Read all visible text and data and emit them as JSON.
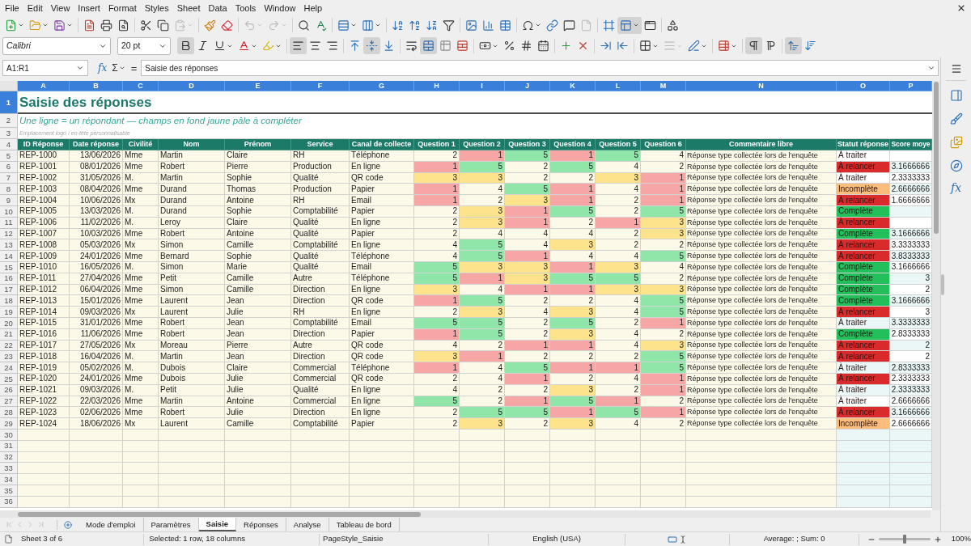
{
  "menu_bar": {
    "items": [
      "File",
      "Edit",
      "View",
      "Insert",
      "Format",
      "Styles",
      "Sheet",
      "Data",
      "Tools",
      "Window",
      "Help"
    ]
  },
  "standard_toolbar": {
    "paste_disabled": true,
    "undo_disabled": true,
    "redo_disabled": true,
    "headers_footers_disabled": true,
    "freeze_pressed": true
  },
  "formatting_toolbar": {
    "font_name": "Calibri",
    "font_size": "20 pt",
    "bold": true,
    "italic": false,
    "underline": false,
    "align_left": true,
    "align_center": false,
    "align_right": false,
    "align_top": false,
    "align_middle": true,
    "align_bottom": false,
    "wrap_text": false,
    "merge_center": true,
    "border_style_disabled": true,
    "left_to_right": true,
    "right_to_left": false,
    "text_up": true,
    "text_down": false
  },
  "formula_bar": {
    "name_box": "A1:R1",
    "function_wizard": "fx",
    "sum": "Σ",
    "equals": "=",
    "content": "Saisie des réponses"
  },
  "sidebar": {
    "functions": "fx"
  },
  "sheet": {
    "columns": [
      {
        "letter": "A",
        "header": "ID Réponse",
        "selected": true
      },
      {
        "letter": "B",
        "header": "Date réponse",
        "selected": true
      },
      {
        "letter": "C",
        "header": "Civilité",
        "selected": true
      },
      {
        "letter": "D",
        "header": "Nom",
        "selected": true
      },
      {
        "letter": "E",
        "header": "Prénom",
        "selected": true
      },
      {
        "letter": "F",
        "header": "Service",
        "selected": true
      },
      {
        "letter": "G",
        "header": "Canal de collecte",
        "selected": true
      },
      {
        "letter": "H",
        "header": "Question 1",
        "selected": true
      },
      {
        "letter": "I",
        "header": "Question 2",
        "selected": true
      },
      {
        "letter": "J",
        "header": "Question 3",
        "selected": true
      },
      {
        "letter": "K",
        "header": "Question 4",
        "selected": true
      },
      {
        "letter": "L",
        "header": "Question 5",
        "selected": true
      },
      {
        "letter": "M",
        "header": "Question 6",
        "selected": true
      },
      {
        "letter": "N",
        "header": "Commentaire libre",
        "selected": true
      },
      {
        "letter": "O",
        "header": "Statut réponse",
        "selected": true
      },
      {
        "letter": "P",
        "header": "Score moye",
        "selected": true
      }
    ],
    "header_rows": [
      {
        "number": "1",
        "selected": true
      },
      {
        "number": "2",
        "selected": false
      },
      {
        "number": "3",
        "selected": false
      },
      {
        "number": "4",
        "selected": false
      }
    ],
    "title": "Saisie des réponses",
    "subtitle": "Une ligne = un répondant — champs en fond jaune pâle à compléter",
    "note": "Emplacement logo / en-tête personnalisable",
    "rows": [
      {
        "number": "5",
        "selected": false,
        "id": "REP-1000",
        "date": "13/06/2026",
        "civility": "Mme",
        "last_name": "Martin",
        "first_name": "Claire",
        "service": "RH",
        "channel": "Téléphone",
        "answers": [
          {
            "value": "2",
            "color": "#fdf9e9"
          },
          {
            "value": "1",
            "color": "#f7a6a6"
          },
          {
            "value": "5",
            "color": "#8fe6a8"
          },
          {
            "value": "1",
            "color": "#f7a6a6"
          },
          {
            "value": "5",
            "color": "#8fe6a8"
          },
          {
            "value": "4",
            "color": "#fdf9e9"
          }
        ],
        "comment": "Réponse type collectée lors de l'enquête",
        "status": {
          "label": "À traiter",
          "color": "#ffffff"
        }
      },
      {
        "number": "6",
        "selected": false,
        "id": "REP-1001",
        "date": "08/01/2026",
        "civility": "Mme",
        "last_name": "Robert",
        "first_name": "Pierre",
        "service": "Production",
        "channel": "En ligne",
        "answers": [
          {
            "value": "1",
            "color": "#f7a6a6"
          },
          {
            "value": "5",
            "color": "#8fe6a8"
          },
          {
            "value": "2",
            "color": "#fdf9e9"
          },
          {
            "value": "5",
            "color": "#8fe6a8"
          },
          {
            "value": "4",
            "color": "#fdf9e9"
          },
          {
            "value": "2",
            "color": "#fdf9e9"
          }
        ],
        "comment": "Réponse type collectée lors de l'enquête",
        "status": {
          "label": "À relancer",
          "color": "#d92b2b"
        },
        "score": "3.1666666"
      },
      {
        "number": "7",
        "selected": false,
        "id": "REP-1002",
        "date": "31/05/2026",
        "civility": "M.",
        "last_name": "Martin",
        "first_name": "Sophie",
        "service": "Qualité",
        "channel": "QR code",
        "answers": [
          {
            "value": "3",
            "color": "#fde38c"
          },
          {
            "value": "3",
            "color": "#fde38c"
          },
          {
            "value": "2",
            "color": "#fdf9e9"
          },
          {
            "value": "2",
            "color": "#fdf9e9"
          },
          {
            "value": "3",
            "color": "#fde38c"
          },
          {
            "value": "1",
            "color": "#f7a6a6"
          }
        ],
        "comment": "Réponse type collectée lors de l'enquête",
        "status": {
          "label": "À traiter",
          "color": "#ffffff"
        },
        "score": "2.3333333"
      },
      {
        "number": "8",
        "selected": false,
        "id": "REP-1003",
        "date": "08/04/2026",
        "civility": "Mme",
        "last_name": "Durand",
        "first_name": "Thomas",
        "service": "Production",
        "channel": "Papier",
        "answers": [
          {
            "value": "1",
            "color": "#f7a6a6"
          },
          {
            "value": "4",
            "color": "#fdf9e9"
          },
          {
            "value": "5",
            "color": "#8fe6a8"
          },
          {
            "value": "1",
            "color": "#f7a6a6"
          },
          {
            "value": "4",
            "color": "#fdf9e9"
          },
          {
            "value": "1",
            "color": "#f7a6a6"
          }
        ],
        "comment": "Réponse type collectée lors de l'enquête",
        "status": {
          "label": "Incomplète",
          "color": "#fbbd7c"
        },
        "score": "2.6666666"
      },
      {
        "number": "9",
        "selected": false,
        "id": "REP-1004",
        "date": "10/06/2026",
        "civility": "Mx",
        "last_name": "Durand",
        "first_name": "Antoine",
        "service": "RH",
        "channel": "Email",
        "answers": [
          {
            "value": "1",
            "color": "#f7a6a6"
          },
          {
            "value": "2",
            "color": "#fdf9e9"
          },
          {
            "value": "3",
            "color": "#fde38c"
          },
          {
            "value": "1",
            "color": "#f7a6a6"
          },
          {
            "value": "2",
            "color": "#fdf9e9"
          },
          {
            "value": "1",
            "color": "#f7a6a6"
          }
        ],
        "comment": "Réponse type collectée lors de l'enquête",
        "status": {
          "label": "À relancer",
          "color": "#d92b2b"
        },
        "score": "1.6666666"
      },
      {
        "number": "10",
        "selected": false,
        "id": "REP-1005",
        "date": "13/03/2026",
        "civility": "M.",
        "last_name": "Durand",
        "first_name": "Sophie",
        "service": "Comptabilité",
        "channel": "Papier",
        "answers": [
          {
            "value": "2",
            "color": "#fdf9e9"
          },
          {
            "value": "3",
            "color": "#fde38c"
          },
          {
            "value": "1",
            "color": "#f7a6a6"
          },
          {
            "value": "5",
            "color": "#8fe6a8"
          },
          {
            "value": "2",
            "color": "#fdf9e9"
          },
          {
            "value": "5",
            "color": "#8fe6a8"
          }
        ],
        "comment": "Réponse type collectée lors de l'enquête",
        "status": {
          "label": "Complète",
          "color": "#22bf5a"
        }
      },
      {
        "number": "11",
        "selected": false,
        "id": "REP-1006",
        "date": "11/02/2026",
        "civility": "M.",
        "last_name": "Leroy",
        "first_name": "Claire",
        "service": "Qualité",
        "channel": "En ligne",
        "answers": [
          {
            "value": "2",
            "color": "#fdf9e9"
          },
          {
            "value": "3",
            "color": "#fde38c"
          },
          {
            "value": "1",
            "color": "#f7a6a6"
          },
          {
            "value": "2",
            "color": "#fdf9e9"
          },
          {
            "value": "1",
            "color": "#f7a6a6"
          },
          {
            "value": "3",
            "color": "#fde38c"
          }
        ],
        "comment": "Réponse type collectée lors de l'enquête",
        "status": {
          "label": "À relancer",
          "color": "#d92b2b"
        }
      },
      {
        "number": "12",
        "selected": false,
        "id": "REP-1007",
        "date": "10/03/2026",
        "civility": "Mme",
        "last_name": "Robert",
        "first_name": "Antoine",
        "service": "Qualité",
        "channel": "Papier",
        "answers": [
          {
            "value": "2",
            "color": "#fdf9e9"
          },
          {
            "value": "4",
            "color": "#fdf9e9"
          },
          {
            "value": "4",
            "color": "#fdf9e9"
          },
          {
            "value": "4",
            "color": "#fdf9e9"
          },
          {
            "value": "2",
            "color": "#fdf9e9"
          },
          {
            "value": "3",
            "color": "#fde38c"
          }
        ],
        "comment": "Réponse type collectée lors de l'enquête",
        "status": {
          "label": "Complète",
          "color": "#22bf5a"
        },
        "score": "3.1666666"
      },
      {
        "number": "13",
        "selected": false,
        "id": "REP-1008",
        "date": "05/03/2026",
        "civility": "Mx",
        "last_name": "Simon",
        "first_name": "Camille",
        "service": "Comptabilité",
        "channel": "En ligne",
        "answers": [
          {
            "value": "4",
            "color": "#fdf9e9"
          },
          {
            "value": "5",
            "color": "#8fe6a8"
          },
          {
            "value": "4",
            "color": "#fdf9e9"
          },
          {
            "value": "3",
            "color": "#fde38c"
          },
          {
            "value": "2",
            "color": "#fdf9e9"
          },
          {
            "value": "2",
            "color": "#fdf9e9"
          }
        ],
        "comment": "Réponse type collectée lors de l'enquête",
        "status": {
          "label": "À relancer",
          "color": "#d92b2b"
        },
        "score": "3.3333333"
      },
      {
        "number": "14",
        "selected": false,
        "id": "REP-1009",
        "date": "24/01/2026",
        "civility": "Mme",
        "last_name": "Bernard",
        "first_name": "Sophie",
        "service": "Qualité",
        "channel": "Téléphone",
        "answers": [
          {
            "value": "4",
            "color": "#fdf9e9"
          },
          {
            "value": "5",
            "color": "#8fe6a8"
          },
          {
            "value": "1",
            "color": "#f7a6a6"
          },
          {
            "value": "4",
            "color": "#fdf9e9"
          },
          {
            "value": "4",
            "color": "#fdf9e9"
          },
          {
            "value": "5",
            "color": "#8fe6a8"
          }
        ],
        "comment": "Réponse type collectée lors de l'enquête",
        "status": {
          "label": "À relancer",
          "color": "#d92b2b"
        },
        "score": "3.8333333"
      },
      {
        "number": "15",
        "selected": false,
        "id": "REP-1010",
        "date": "16/05/2026",
        "civility": "M.",
        "last_name": "Simon",
        "first_name": "Marie",
        "service": "Qualité",
        "channel": "Email",
        "answers": [
          {
            "value": "5",
            "color": "#8fe6a8"
          },
          {
            "value": "3",
            "color": "#fde38c"
          },
          {
            "value": "3",
            "color": "#fde38c"
          },
          {
            "value": "1",
            "color": "#f7a6a6"
          },
          {
            "value": "3",
            "color": "#fde38c"
          },
          {
            "value": "4",
            "color": "#fdf9e9"
          }
        ],
        "comment": "Réponse type collectée lors de l'enquête",
        "status": {
          "label": "Complète",
          "color": "#22bf5a"
        },
        "score": "3.1666666"
      },
      {
        "number": "16",
        "selected": false,
        "id": "REP-1011",
        "date": "27/04/2026",
        "civility": "Mme",
        "last_name": "Petit",
        "first_name": "Camille",
        "service": "Autre",
        "channel": "Téléphone",
        "answers": [
          {
            "value": "5",
            "color": "#8fe6a8"
          },
          {
            "value": "1",
            "color": "#f7a6a6"
          },
          {
            "value": "3",
            "color": "#fde38c"
          },
          {
            "value": "5",
            "color": "#8fe6a8"
          },
          {
            "value": "5",
            "color": "#8fe6a8"
          },
          {
            "value": "2",
            "color": "#fdf9e9"
          }
        ],
        "comment": "Réponse type collectée lors de l'enquête",
        "status": {
          "label": "Complète",
          "color": "#22bf5a"
        },
        "score": "3"
      },
      {
        "number": "17",
        "selected": false,
        "id": "REP-1012",
        "date": "06/04/2026",
        "civility": "Mme",
        "last_name": "Simon",
        "first_name": "Camille",
        "service": "Direction",
        "channel": "En ligne",
        "answers": [
          {
            "value": "3",
            "color": "#fde38c"
          },
          {
            "value": "4",
            "color": "#fdf9e9"
          },
          {
            "value": "1",
            "color": "#f7a6a6"
          },
          {
            "value": "1",
            "color": "#f7a6a6"
          },
          {
            "value": "3",
            "color": "#fde38c"
          },
          {
            "value": "3",
            "color": "#fde38c"
          }
        ],
        "comment": "Réponse type collectée lors de l'enquête",
        "status": {
          "label": "Complète",
          "color": "#22bf5a"
        },
        "score": "2"
      },
      {
        "number": "18",
        "selected": false,
        "id": "REP-1013",
        "date": "15/01/2026",
        "civility": "Mme",
        "last_name": "Laurent",
        "first_name": "Jean",
        "service": "Direction",
        "channel": "QR code",
        "answers": [
          {
            "value": "1",
            "color": "#f7a6a6"
          },
          {
            "value": "5",
            "color": "#8fe6a8"
          },
          {
            "value": "2",
            "color": "#fdf9e9"
          },
          {
            "value": "2",
            "color": "#fdf9e9"
          },
          {
            "value": "4",
            "color": "#fdf9e9"
          },
          {
            "value": "5",
            "color": "#8fe6a8"
          }
        ],
        "comment": "Réponse type collectée lors de l'enquête",
        "status": {
          "label": "Complète",
          "color": "#22bf5a"
        },
        "score": "3.1666666"
      },
      {
        "number": "19",
        "selected": false,
        "id": "REP-1014",
        "date": "09/03/2026",
        "civility": "Mx",
        "last_name": "Laurent",
        "first_name": "Julie",
        "service": "RH",
        "channel": "En ligne",
        "answers": [
          {
            "value": "2",
            "color": "#fdf9e9"
          },
          {
            "value": "3",
            "color": "#fde38c"
          },
          {
            "value": "4",
            "color": "#fdf9e9"
          },
          {
            "value": "3",
            "color": "#fde38c"
          },
          {
            "value": "4",
            "color": "#fdf9e9"
          },
          {
            "value": "5",
            "color": "#8fe6a8"
          }
        ],
        "comment": "Réponse type collectée lors de l'enquête",
        "status": {
          "label": "À relancer",
          "color": "#d92b2b"
        },
        "score": "3"
      },
      {
        "number": "20",
        "selected": false,
        "id": "REP-1015",
        "date": "31/01/2026",
        "civility": "Mme",
        "last_name": "Robert",
        "first_name": "Jean",
        "service": "Comptabilité",
        "channel": "Email",
        "answers": [
          {
            "value": "5",
            "color": "#8fe6a8"
          },
          {
            "value": "5",
            "color": "#8fe6a8"
          },
          {
            "value": "2",
            "color": "#fdf9e9"
          },
          {
            "value": "5",
            "color": "#8fe6a8"
          },
          {
            "value": "2",
            "color": "#fdf9e9"
          },
          {
            "value": "1",
            "color": "#f7a6a6"
          }
        ],
        "comment": "Réponse type collectée lors de l'enquête",
        "status": {
          "label": "À traiter",
          "color": "#ebf7f7"
        },
        "score": "3.3333333"
      },
      {
        "number": "21",
        "selected": false,
        "id": "REP-1016",
        "date": "11/06/2026",
        "civility": "Mme",
        "last_name": "Robert",
        "first_name": "Jean",
        "service": "Direction",
        "channel": "Papier",
        "answers": [
          {
            "value": "1",
            "color": "#f7a6a6"
          },
          {
            "value": "5",
            "color": "#8fe6a8"
          },
          {
            "value": "2",
            "color": "#fdf9e9"
          },
          {
            "value": "3",
            "color": "#fde38c"
          },
          {
            "value": "4",
            "color": "#fdf9e9"
          },
          {
            "value": "2",
            "color": "#fdf9e9"
          }
        ],
        "comment": "Réponse type collectée lors de l'enquête",
        "status": {
          "label": "Complète",
          "color": "#22bf5a"
        },
        "score": "2.8333333"
      },
      {
        "number": "22",
        "selected": false,
        "id": "REP-1017",
        "date": "27/05/2026",
        "civility": "Mx",
        "last_name": "Moreau",
        "first_name": "Pierre",
        "service": "Autre",
        "channel": "QR code",
        "answers": [
          {
            "value": "4",
            "color": "#fdf9e9"
          },
          {
            "value": "2",
            "color": "#fdf9e9"
          },
          {
            "value": "1",
            "color": "#f7a6a6"
          },
          {
            "value": "1",
            "color": "#f7a6a6"
          },
          {
            "value": "4",
            "color": "#fdf9e9"
          },
          {
            "value": "3",
            "color": "#fde38c"
          }
        ],
        "comment": "Réponse type collectée lors de l'enquête",
        "status": {
          "label": "À relancer",
          "color": "#d92b2b"
        },
        "score": "2"
      },
      {
        "number": "23",
        "selected": false,
        "id": "REP-1018",
        "date": "16/04/2026",
        "civility": "M.",
        "last_name": "Martin",
        "first_name": "Jean",
        "service": "Direction",
        "channel": "QR code",
        "answers": [
          {
            "value": "3",
            "color": "#fde38c"
          },
          {
            "value": "1",
            "color": "#f7a6a6"
          },
          {
            "value": "2",
            "color": "#fdf9e9"
          },
          {
            "value": "2",
            "color": "#fdf9e9"
          },
          {
            "value": "2",
            "color": "#fdf9e9"
          },
          {
            "value": "5",
            "color": "#8fe6a8"
          }
        ],
        "comment": "Réponse type collectée lors de l'enquête",
        "status": {
          "label": "À relancer",
          "color": "#d92b2b"
        },
        "score": "2"
      },
      {
        "number": "24",
        "selected": false,
        "id": "REP-1019",
        "date": "05/02/2026",
        "civility": "M.",
        "last_name": "Dubois",
        "first_name": "Claire",
        "service": "Commercial",
        "channel": "Téléphone",
        "answers": [
          {
            "value": "1",
            "color": "#f7a6a6"
          },
          {
            "value": "4",
            "color": "#fdf9e9"
          },
          {
            "value": "5",
            "color": "#8fe6a8"
          },
          {
            "value": "1",
            "color": "#f7a6a6"
          },
          {
            "value": "1",
            "color": "#f7a6a6"
          },
          {
            "value": "5",
            "color": "#8fe6a8"
          }
        ],
        "comment": "Réponse type collectée lors de l'enquête",
        "status": {
          "label": "À traiter",
          "color": "#ebf7f7"
        },
        "score": "2.8333333"
      },
      {
        "number": "25",
        "selected": false,
        "id": "REP-1020",
        "date": "24/01/2026",
        "civility": "Mme",
        "last_name": "Dubois",
        "first_name": "Julie",
        "service": "Commercial",
        "channel": "QR code",
        "answers": [
          {
            "value": "2",
            "color": "#fdf9e9"
          },
          {
            "value": "4",
            "color": "#fdf9e9"
          },
          {
            "value": "1",
            "color": "#f7a6a6"
          },
          {
            "value": "2",
            "color": "#fdf9e9"
          },
          {
            "value": "4",
            "color": "#fdf9e9"
          },
          {
            "value": "1",
            "color": "#f7a6a6"
          }
        ],
        "comment": "Réponse type collectée lors de l'enquête",
        "status": {
          "label": "À relancer",
          "color": "#d92b2b"
        },
        "score": "2.3333333"
      },
      {
        "number": "26",
        "selected": false,
        "id": "REP-1021",
        "date": "09/03/2026",
        "civility": "M.",
        "last_name": "Petit",
        "first_name": "Julie",
        "service": "Qualité",
        "channel": "En ligne",
        "answers": [
          {
            "value": "4",
            "color": "#fdf9e9"
          },
          {
            "value": "2",
            "color": "#fdf9e9"
          },
          {
            "value": "2",
            "color": "#fdf9e9"
          },
          {
            "value": "3",
            "color": "#fde38c"
          },
          {
            "value": "2",
            "color": "#fdf9e9"
          },
          {
            "value": "1",
            "color": "#f7a6a6"
          }
        ],
        "comment": "Réponse type collectée lors de l'enquête",
        "status": {
          "label": "À traiter",
          "color": "#ebf7f7"
        },
        "score": "2.3333333"
      },
      {
        "number": "27",
        "selected": false,
        "id": "REP-1022",
        "date": "22/03/2026",
        "civility": "Mme",
        "last_name": "Martin",
        "first_name": "Antoine",
        "service": "Commercial",
        "channel": "En ligne",
        "answers": [
          {
            "value": "5",
            "color": "#8fe6a8"
          },
          {
            "value": "2",
            "color": "#fdf9e9"
          },
          {
            "value": "1",
            "color": "#f7a6a6"
          },
          {
            "value": "5",
            "color": "#8fe6a8"
          },
          {
            "value": "1",
            "color": "#f7a6a6"
          },
          {
            "value": "2",
            "color": "#fdf9e9"
          }
        ],
        "comment": "Réponse type collectée lors de l'enquête",
        "status": {
          "label": "À traiter",
          "color": "#ffffff"
        },
        "score": "2.6666666"
      },
      {
        "number": "28",
        "selected": false,
        "id": "REP-1023",
        "date": "02/06/2026",
        "civility": "Mme",
        "last_name": "Robert",
        "first_name": "Julie",
        "service": "Direction",
        "channel": "En ligne",
        "answers": [
          {
            "value": "2",
            "color": "#fdf9e9"
          },
          {
            "value": "5",
            "color": "#8fe6a8"
          },
          {
            "value": "5",
            "color": "#8fe6a8"
          },
          {
            "value": "1",
            "color": "#f7a6a6"
          },
          {
            "value": "5",
            "color": "#8fe6a8"
          },
          {
            "value": "1",
            "color": "#f7a6a6"
          }
        ],
        "comment": "Réponse type collectée lors de l'enquête",
        "status": {
          "label": "À relancer",
          "color": "#d92b2b"
        },
        "score": "3.1666666"
      },
      {
        "number": "29",
        "selected": false,
        "id": "REP-1024",
        "date": "18/06/2026",
        "civility": "Mx",
        "last_name": "Laurent",
        "first_name": "Camille",
        "service": "Comptabilité",
        "channel": "Papier",
        "answers": [
          {
            "value": "2",
            "color": "#fdf9e9"
          },
          {
            "value": "3",
            "color": "#fde38c"
          },
          {
            "value": "2",
            "color": "#fdf9e9"
          },
          {
            "value": "3",
            "color": "#fde38c"
          },
          {
            "value": "4",
            "color": "#fdf9e9"
          },
          {
            "value": "2",
            "color": "#fdf9e9"
          }
        ],
        "comment": "Réponse type collectée lors de l'enquête",
        "status": {
          "label": "Incomplète",
          "color": "#fbbd7c"
        },
        "score": "2.6666666"
      }
    ],
    "empty_rows": [
      {
        "number": "30",
        "selected": false
      },
      {
        "number": "31",
        "selected": false
      },
      {
        "number": "32",
        "selected": false
      },
      {
        "number": "33",
        "selected": false
      },
      {
        "number": "34",
        "selected": false
      },
      {
        "number": "35",
        "selected": false
      },
      {
        "number": "36",
        "selected": false
      }
    ]
  },
  "sheet_tabs": [
    {
      "label": "Mode d'emploi",
      "selected": false
    },
    {
      "label": "Paramètres",
      "selected": false
    },
    {
      "label": "Saisie",
      "selected": true
    },
    {
      "label": "Réponses",
      "selected": false
    },
    {
      "label": "Analyse",
      "selected": false
    },
    {
      "label": "Tableau de bord",
      "selected": false
    }
  ],
  "status_bar": {
    "sheet": "Sheet 3 of 6",
    "selection": "Selected: 1 row, 18 columns",
    "page_style": "PageStyle_Saisie",
    "language": "English (USA)",
    "summary": "Average: ; Sum: 0",
    "zoom": {
      "level": 0.5,
      "reading": "100%"
    }
  }
}
